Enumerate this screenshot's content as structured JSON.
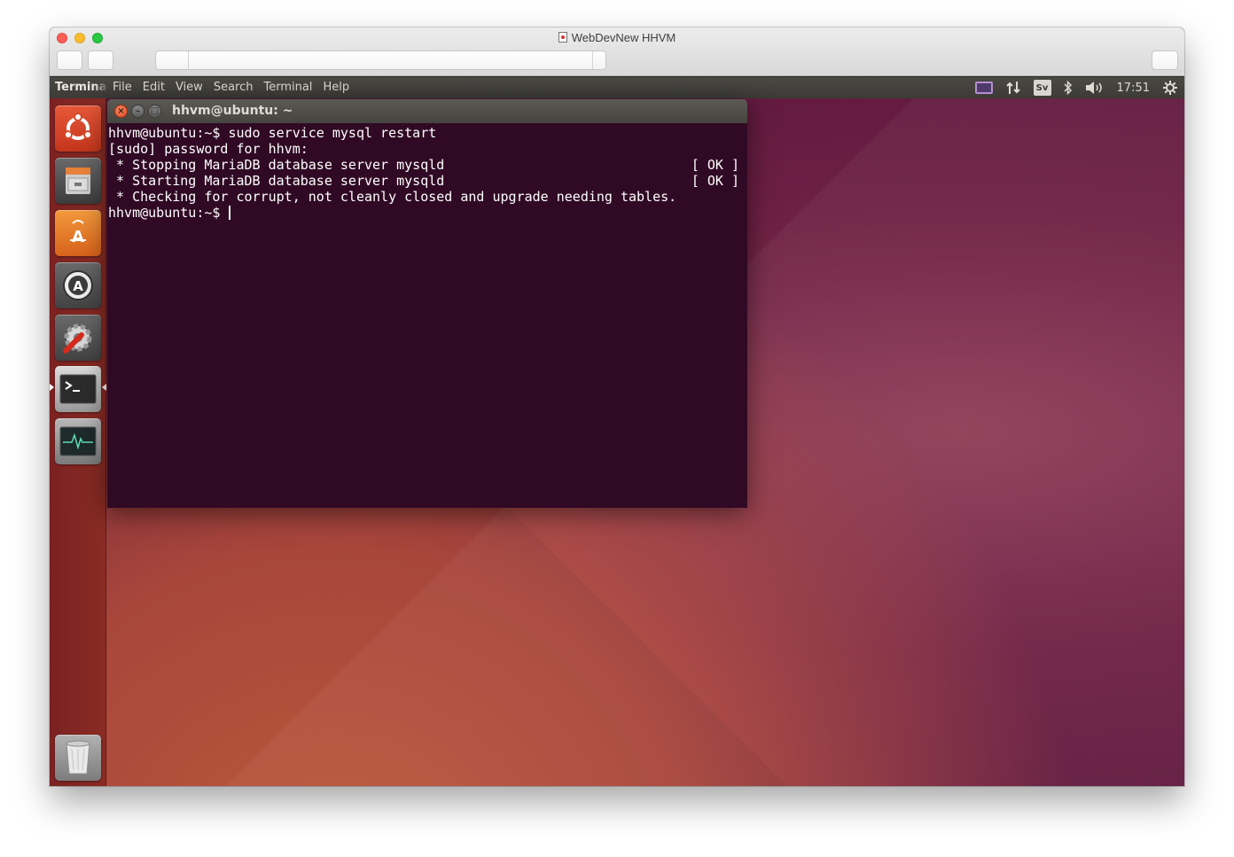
{
  "window": {
    "title": "WebDevNew HHVM"
  },
  "topbar": {
    "app_name": "Terminal",
    "menu": [
      "File",
      "Edit",
      "View",
      "Search",
      "Terminal",
      "Help"
    ],
    "indicators": {
      "keyboard_layout": "Sv",
      "time": "17:51"
    },
    "indicator_icons": [
      "display-icon",
      "network-arrows-icon",
      "keyboard-layout-icon",
      "bluetooth-icon",
      "volume-icon",
      "settings-gear-icon"
    ]
  },
  "launcher": {
    "items": [
      "ubuntu-logo-icon",
      "files-cabinet-icon",
      "software-center-icon",
      "software-updater-icon",
      "system-settings-icon",
      "terminal-icon",
      "system-monitor-icon"
    ],
    "trash": "trash-icon",
    "active_item": "terminal-icon"
  },
  "terminal": {
    "title": "hhvm@ubuntu: ~",
    "buttons": {
      "close": "×",
      "minimize": "–",
      "maximize": "□"
    },
    "lines": [
      {
        "text": "hhvm@ubuntu:~$ sudo service mysql restart",
        "status": ""
      },
      {
        "text": "[sudo] password for hhvm:",
        "status": ""
      },
      {
        "text": " * Stopping MariaDB database server mysqld",
        "status": "[ OK ]"
      },
      {
        "text": " * Starting MariaDB database server mysqld",
        "status": "[ OK ]"
      },
      {
        "text": " * Checking for corrupt, not cleanly closed and upgrade needing tables.",
        "status": ""
      }
    ],
    "prompt": "hhvm@ubuntu:~$ "
  },
  "colors": {
    "terminal_bg": "#300a24",
    "launcher_bg": "#7a2222",
    "panel_bg": "#3c3b37"
  }
}
